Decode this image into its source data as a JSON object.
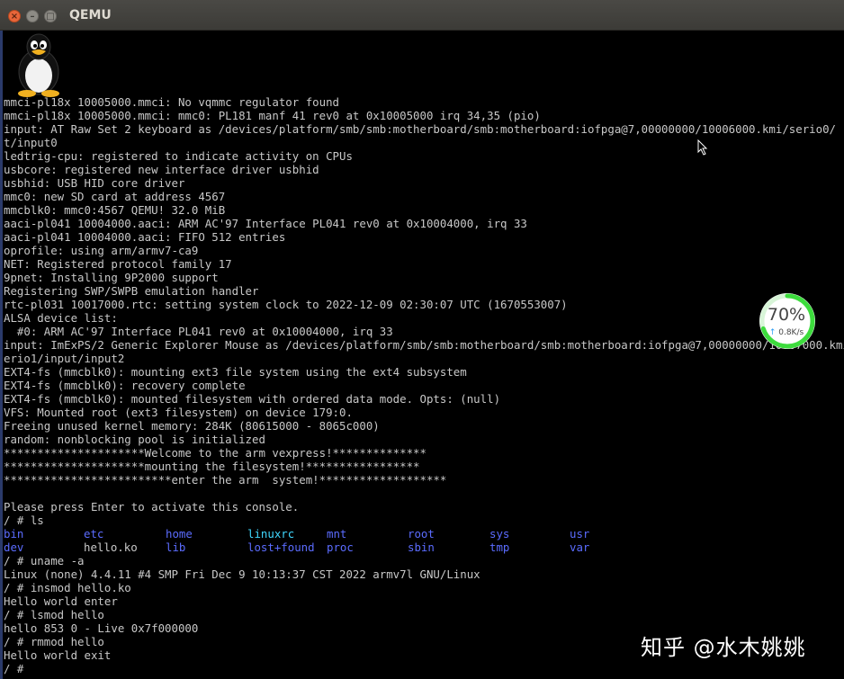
{
  "window": {
    "title": "QEMU"
  },
  "console": {
    "boot_lines": [
      "mmci-pl18x 10005000.mmci: No vqmmc regulator found",
      "mmci-pl18x 10005000.mmci: mmc0: PL181 manf 41 rev0 at 0x10005000 irq 34,35 (pio)",
      "input: AT Raw Set 2 keyboard as /devices/platform/smb/smb:motherboard/smb:motherboard:iofpga@7,00000000/10006000.kmi/serio0/",
      "t/input0",
      "ledtrig-cpu: registered to indicate activity on CPUs",
      "usbcore: registered new interface driver usbhid",
      "usbhid: USB HID core driver",
      "mmc0: new SD card at address 4567",
      "mmcblk0: mmc0:4567 QEMU! 32.0 MiB",
      "aaci-pl041 10004000.aaci: ARM AC'97 Interface PL041 rev0 at 0x10004000, irq 33",
      "aaci-pl041 10004000.aaci: FIFO 512 entries",
      "oprofile: using arm/armv7-ca9",
      "NET: Registered protocol family 17",
      "9pnet: Installing 9P2000 support",
      "Registering SWP/SWPB emulation handler",
      "rtc-pl031 10017000.rtc: setting system clock to 2022-12-09 02:30:07 UTC (1670553007)",
      "ALSA device list:",
      "  #0: ARM AC'97 Interface PL041 rev0 at 0x10004000, irq 33",
      "input: ImExPS/2 Generic Explorer Mouse as /devices/platform/smb/smb:motherboard/smb:motherboard:iofpga@7,00000000/10007000.kmi/s",
      "erio1/input/input2",
      "EXT4-fs (mmcblk0): mounting ext3 file system using the ext4 subsystem",
      "EXT4-fs (mmcblk0): recovery complete",
      "EXT4-fs (mmcblk0): mounted filesystem with ordered data mode. Opts: (null)",
      "VFS: Mounted root (ext3 filesystem) on device 179:0.",
      "Freeing unused kernel memory: 284K (80615000 - 8065c000)",
      "random: nonblocking pool is initialized",
      "*********************Welcome to the arm vexpress!**************",
      "*********************mounting the filesystem!*****************",
      "*************************enter the arm  system!*******************",
      "",
      "Please press Enter to activate this console.",
      "/ # ls"
    ],
    "ls_entries": [
      [
        {
          "name": "bin",
          "color": "blue"
        },
        {
          "name": "etc",
          "color": "blue"
        },
        {
          "name": "home",
          "color": "blue"
        },
        {
          "name": "linuxrc",
          "color": "cyan"
        },
        {
          "name": "mnt",
          "color": "blue"
        },
        {
          "name": "root",
          "color": "blue"
        },
        {
          "name": "sys",
          "color": "blue"
        },
        {
          "name": "usr",
          "color": "blue"
        }
      ],
      [
        {
          "name": "dev",
          "color": "blue"
        },
        {
          "name": "hello.ko",
          "color": "white"
        },
        {
          "name": "lib",
          "color": "blue"
        },
        {
          "name": "lost+found",
          "color": "blue"
        },
        {
          "name": "proc",
          "color": "blue"
        },
        {
          "name": "sbin",
          "color": "blue"
        },
        {
          "name": "tmp",
          "color": "blue"
        },
        {
          "name": "var",
          "color": "blue"
        }
      ]
    ],
    "after_lines": [
      "/ # uname -a",
      "Linux (none) 4.4.11 #4 SMP Fri Dec 9 10:13:37 CST 2022 armv7l GNU/Linux",
      "/ # insmod hello.ko",
      "Hello world enter",
      "/ # lsmod hello",
      "hello 853 0 - Live 0x7f000000",
      "/ # rmmod hello",
      "Hello world exit",
      "/ # "
    ]
  },
  "overlay": {
    "usage_percent": "70%",
    "usage_fraction": 0.7,
    "net_speed": "0.8K/s"
  },
  "watermark": "知乎 @水木姚姚",
  "colors": {
    "dir": "#5b6cff",
    "link": "#40d8ff",
    "text": "#c8c8c8",
    "gauge_ring": "#3ddc3d"
  }
}
